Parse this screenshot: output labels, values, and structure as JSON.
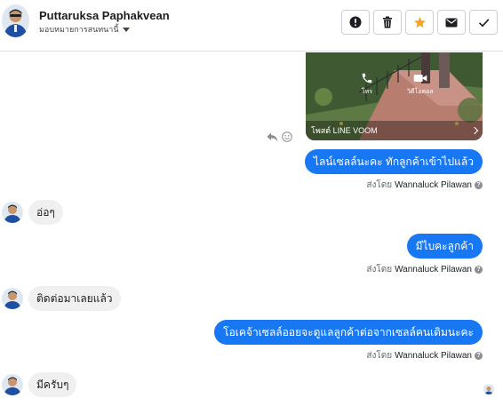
{
  "header": {
    "contact_name": "Puttaruksa Paphakvean",
    "assign_label": "มอบหมายการสนทนานี้",
    "buttons": [
      {
        "name": "report-button",
        "icon": "exclamation-circle-icon"
      },
      {
        "name": "delete-button",
        "icon": "trash-icon"
      },
      {
        "name": "star-button",
        "icon": "star-icon"
      },
      {
        "name": "mail-button",
        "icon": "envelope-icon"
      },
      {
        "name": "done-button",
        "icon": "check-icon"
      }
    ]
  },
  "colors": {
    "accent": "#1877f2",
    "star": "#f5a623",
    "incoming_bubble": "#f0f0f0"
  },
  "media": {
    "call_label": "โทร",
    "video_label": "วิดีโอคอล",
    "footer_text": "โพสต์ LINE VOOM"
  },
  "messages": [
    {
      "direction": "out",
      "text": "ไลน์เซลล์นะคะ  ทักลูกค้าเข้าไปแล้ว",
      "sent_by_prefix": "ส่งโดย",
      "sent_by_name": "Wannaluck Pilawan"
    },
    {
      "direction": "in",
      "text": "อ่อๆ"
    },
    {
      "direction": "out",
      "text": "มีไบคะลูกค้า",
      "sent_by_prefix": "ส่งโดย",
      "sent_by_name": "Wannaluck Pilawan"
    },
    {
      "direction": "in",
      "text": "ติดต่อมาเลยแล้ว"
    },
    {
      "direction": "out",
      "text": "โอเคจ้าเซลล์ออยจะดูแลลูกค้าต่อจากเซลล์คนเดิมนะคะ",
      "sent_by_prefix": "ส่งโดย",
      "sent_by_name": "Wannaluck Pilawan"
    },
    {
      "direction": "in",
      "text": "มีครับๆ"
    }
  ]
}
